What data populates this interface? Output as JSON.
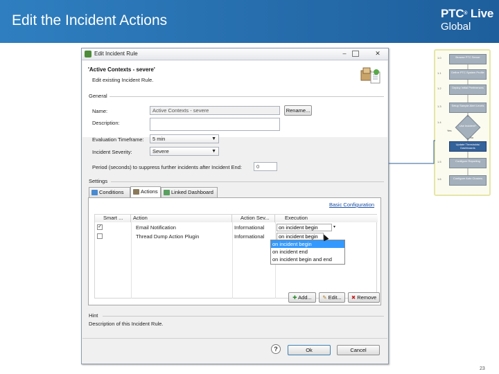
{
  "slide": {
    "title": "Edit the Incident Actions",
    "logo_line1": "PTC",
    "logo_reg": "®",
    "logo_line1b": " Live",
    "logo_line2": "Global",
    "page_number": "23",
    "header_color": "#2a74b6"
  },
  "dialog": {
    "window_title": "Edit Incident Rule",
    "heading": "'Active Contexts - severe'",
    "subtitle": "Edit existing Incident Rule.",
    "general": {
      "group_label": "General",
      "name_label": "Name:",
      "name_value": "Active Contexts - severe",
      "rename_button": "Rename...",
      "description_label": "Description:",
      "description_value": "",
      "eval_label": "Evaluation Timeframe:",
      "eval_value": "5 min",
      "severity_label": "Incident Severity:",
      "severity_value": "Severe",
      "period_label": "Period (seconds) to suppress further incidents after Incident End:",
      "period_value": "0"
    },
    "settings": {
      "group_label": "Settings",
      "tabs": [
        {
          "label": "Conditions"
        },
        {
          "label": "Actions"
        },
        {
          "label": "Linked Dashboard"
        }
      ],
      "basic_config_link": "Basic Configuration",
      "columns": [
        "Smart ...",
        "Action",
        "Action Sev...",
        "Execution"
      ],
      "rows": [
        {
          "checked": true,
          "action": "Email Notification",
          "severity": "Informational",
          "execution": "on incident begin"
        },
        {
          "checked": false,
          "action": "Thread Dump Action Plugin",
          "severity": "Informational",
          "execution": "on incident begin"
        }
      ],
      "execution_options": [
        "on incident begin",
        "on incident end",
        "on incident begin and end"
      ],
      "selected_option_index": 0,
      "add_button": "Add...",
      "edit_button": "Edit...",
      "remove_button": "Remove"
    },
    "hint": {
      "group_label": "Hint",
      "text": "Description of this Incident Rule."
    },
    "help_glyph": "?",
    "ok_button": "Ok",
    "cancel_button": "Cancel"
  },
  "flow": {
    "steps": [
      {
        "num": "1.0",
        "label": "Browse PTC Server"
      },
      {
        "num": "1.1",
        "label": "Define PTC System Profile"
      },
      {
        "num": "1.2",
        "label": "Deploy Initial Preferences"
      },
      {
        "num": "1.3",
        "label": "Setup Sample Alert Levels"
      },
      {
        "num": "1.4",
        "label": "Update Thresholds/ Dashboards"
      },
      {
        "num": "1.5",
        "label": "Configure Reporting"
      },
      {
        "num": "1.6",
        "label": "Configure Auto Clusters"
      }
    ],
    "decision": "Use Incident?",
    "yes": "Yes",
    "no": "No"
  }
}
